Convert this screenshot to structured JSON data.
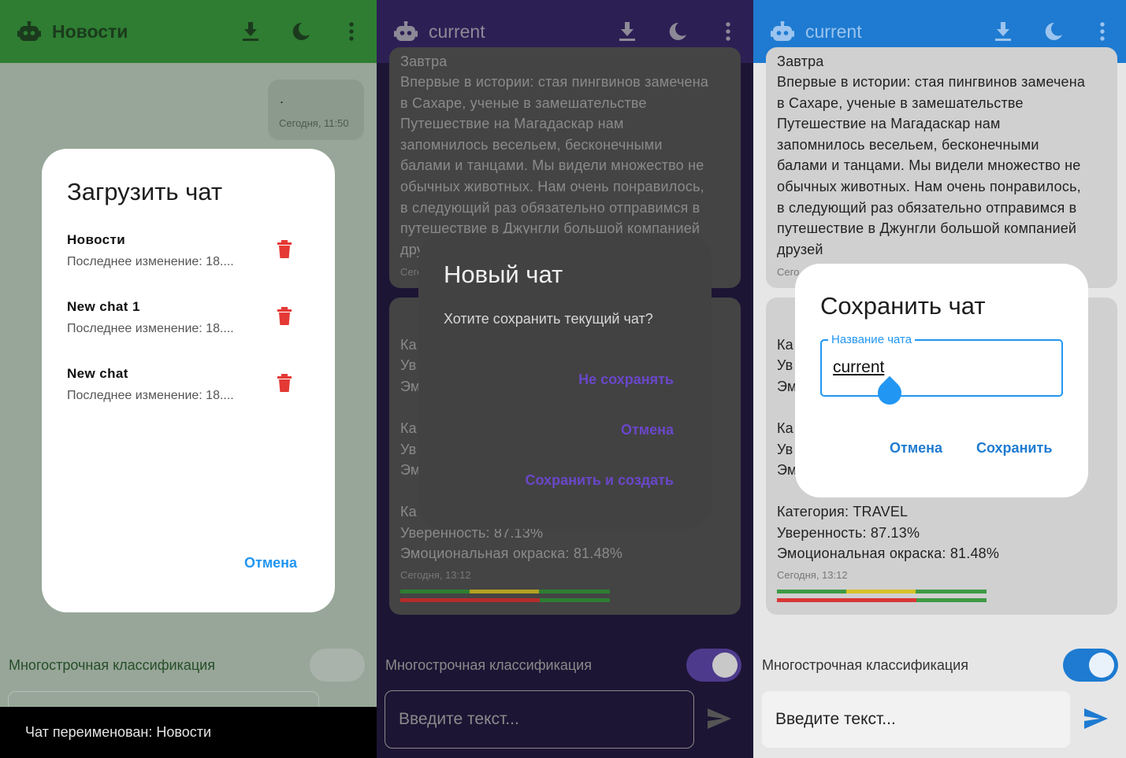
{
  "colors": {
    "green_appbar": "#2e7d32",
    "purple_accent": "#6a47c9",
    "blue_appbar": "#1e7bd1",
    "blue_accent": "#2196f3",
    "delete_red": "#e53935"
  },
  "panel1": {
    "app_title": "Новости",
    "msg_text": ".",
    "msg_time": "Сегодня, 11:50",
    "dialog": {
      "title": "Загрузить чат",
      "items": [
        {
          "name": "Новости",
          "subtitle": "Последнее изменение: 18...."
        },
        {
          "name": "New chat 1",
          "subtitle": "Последнее изменение: 18...."
        },
        {
          "name": "New chat",
          "subtitle": "Последнее изменение: 18...."
        }
      ],
      "cancel": "Отмена"
    },
    "multiline_label": "Многострочная классификация",
    "snackbar": "Чат переименован: Новости"
  },
  "panel2": {
    "app_title": "current",
    "top_msg": {
      "partial_line": "Завтра",
      "lines": [
        "Впервые в истории: стая пингвинов замечена",
        "в Сахаре, ученые в замешательстве",
        "Путешествие на Магадаскар нам",
        "запомнилось весельем, бесконечными",
        "балами и танцами. Мы видели множество не",
        "обычных животных. Нам очень понравилось,",
        "в следующий раз обязательно отправимся в",
        "путешествие в Джунгли большой компанией",
        "дру"
      ],
      "time": "Сего"
    },
    "result": {
      "fragments": [
        "Ка",
        "Ув",
        "Эм",
        "Ка",
        "Ув",
        "Эм",
        "Ка"
      ],
      "confidence": "Уверенность: 87.13%",
      "emotion": "Эмоциональная окраска: 81.48%",
      "time": "Сегодня, 13:12"
    },
    "dialog": {
      "title": "Новый чат",
      "body": "Хотите сохранить текущий чат?",
      "btn_dont_save": "Не сохранять",
      "btn_cancel": "Отмена",
      "btn_save_create": "Сохранить и создать"
    },
    "multiline_label": "Многострочная классификация",
    "input_placeholder": "Введите текст..."
  },
  "panel3": {
    "app_title": "current",
    "top_msg": {
      "partial_line": "Завтра",
      "lines": [
        "Впервые в истории: стая пингвинов замечена",
        "в Сахаре, ученые в замешательстве",
        "Путешествие на Магадаскар нам",
        "запомнилось весельем, бесконечными",
        "балами и танцами. Мы видели множество не",
        "обычных животных. Нам очень понравилось,",
        "в следующий раз обязательно отправимся в",
        "путешествие в Джунгли большой компанией",
        "друзей"
      ],
      "time": "Сего"
    },
    "result": {
      "fragments": [
        "Ка",
        "Ув",
        "Эм",
        "Ка",
        "Ув",
        "Эм"
      ],
      "category": "Категория: TRAVEL",
      "confidence": "Уверенность: 87.13%",
      "emotion": "Эмоциональная окраска: 81.48%",
      "time": "Сегодня, 13:12"
    },
    "dialog": {
      "title": "Сохранить чат",
      "field_label": "Название чата",
      "field_value": "current",
      "btn_cancel": "Отмена",
      "btn_save": "Сохранить"
    },
    "multiline_label": "Многострочная классификация",
    "input_placeholder": "Введите текст..."
  }
}
